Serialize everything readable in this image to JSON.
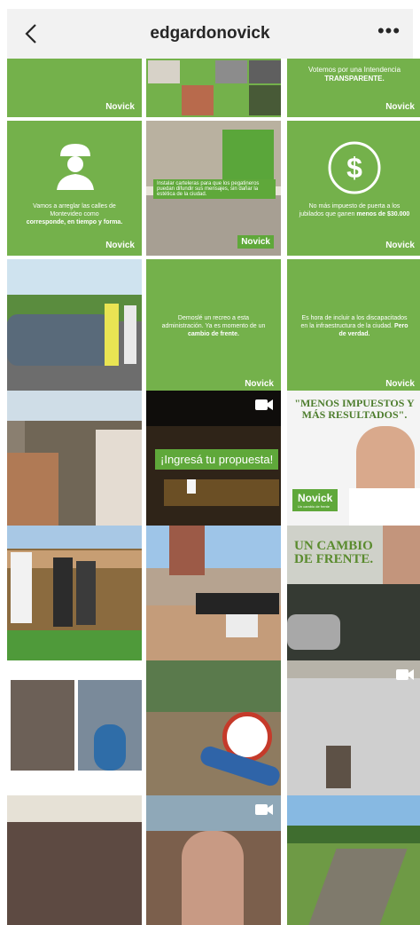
{
  "header": {
    "username": "edgardonovick",
    "more_label": "•••"
  },
  "brand": {
    "logo": "Novick",
    "logo_tag": "Un cambio de frente"
  },
  "posts": [
    {
      "id": "p1",
      "text": "",
      "emphasis": ""
    },
    {
      "id": "p2",
      "text": "",
      "emphasis": ""
    },
    {
      "id": "p3",
      "text": "Votemos por una Intendencia",
      "emphasis": "TRANSPARENTE."
    },
    {
      "id": "p4",
      "text": "Vamos a arreglar las calles de Montevideo como",
      "emphasis": "corresponde, en tiempo y forma."
    },
    {
      "id": "p5",
      "text": "Instalar carteleras para que los pegatineros puedan difundir sus mensajes, sin dañar la estética de la ciudad.",
      "emphasis": ""
    },
    {
      "id": "p6",
      "text": "No más impuesto de puerta a los jubilados que ganen",
      "emphasis": "menos de $30.000"
    },
    {
      "id": "p8",
      "text": "Demoslé un recreo a esta administración. Ya es momento de un",
      "emphasis": "cambio de frente."
    },
    {
      "id": "p9",
      "text": "Es hora de incluir a los discapacitados en la infraestructura de la ciudad.",
      "emphasis": "Pero de verdad."
    },
    {
      "id": "p11",
      "text": "¡Ingresá tu propuesta!",
      "emphasis": ""
    },
    {
      "id": "p12",
      "text": "\"MENOS IMPUESTOS Y MÁS RESULTADOS\".",
      "emphasis": ""
    },
    {
      "id": "p15",
      "text": "UN CAMBIO DE FRENTE.",
      "emphasis": ""
    }
  ]
}
